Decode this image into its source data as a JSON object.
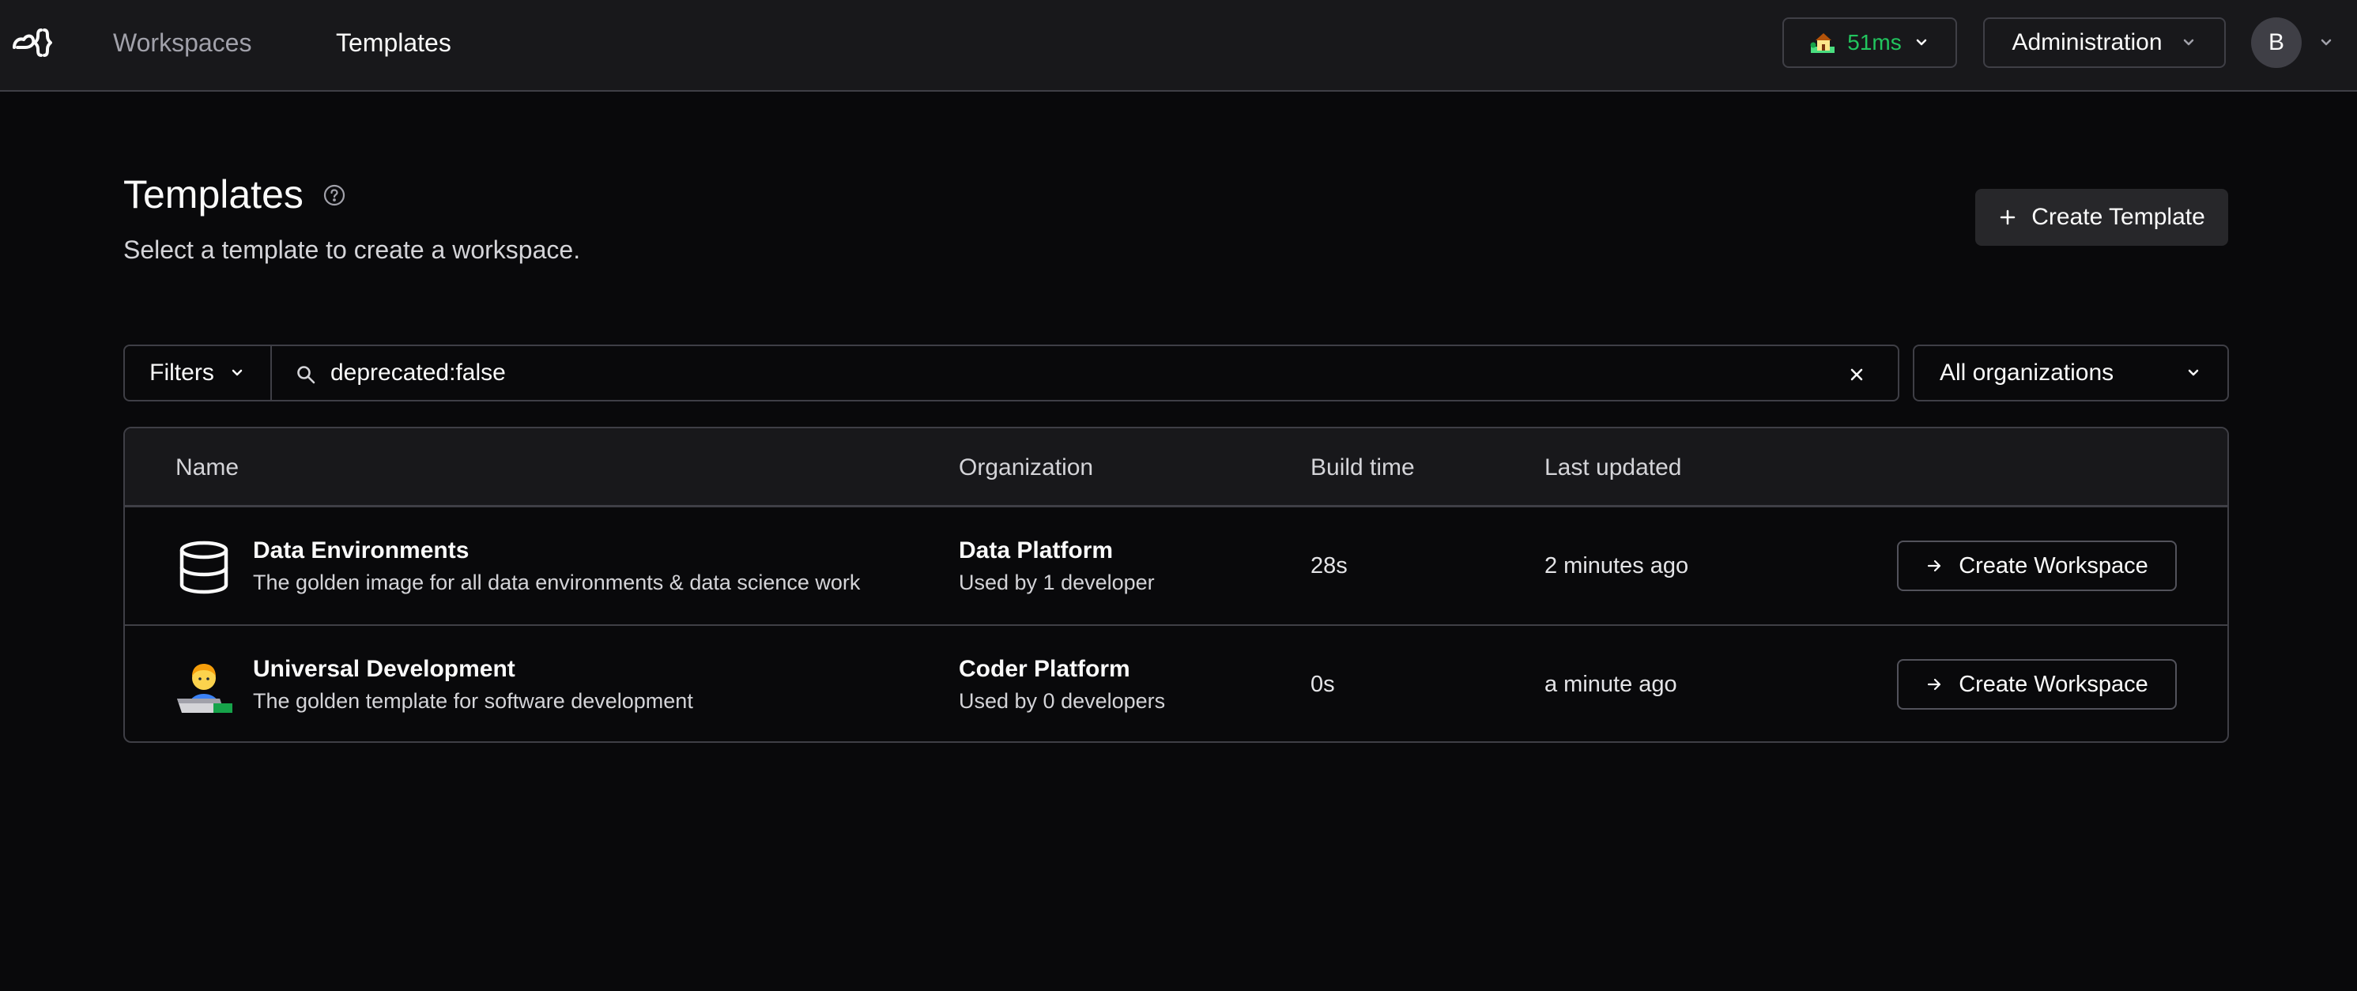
{
  "nav": {
    "workspaces_label": "Workspaces",
    "templates_label": "Templates",
    "active": "Templates"
  },
  "topbar": {
    "latency_icon": "house-with-garden-icon",
    "latency": "51ms",
    "latency_color": "#22c55e",
    "admin_label": "Administration",
    "avatar_initial": "B"
  },
  "header": {
    "title": "Templates",
    "subtitle": "Select a template to create a workspace.",
    "create_button": "Create Template"
  },
  "filters": {
    "filters_label": "Filters",
    "search_value": "deprecated:false",
    "organization_select": "All organizations"
  },
  "table": {
    "columns": [
      "Name",
      "Organization",
      "Build time",
      "Last updated"
    ],
    "rows": [
      {
        "icon": "database-icon",
        "name": "Data Environments",
        "description": "The golden image for all data environments & data science work",
        "organization": "Data Platform",
        "usage": "Used by 1 developer",
        "build_time": "28s",
        "last_updated": "2 minutes ago",
        "action": "Create Workspace"
      },
      {
        "icon": "technologist-icon",
        "name": "Universal Development",
        "description": "The golden template for software development",
        "organization": "Coder Platform",
        "usage": "Used by 0 developers",
        "build_time": "0s",
        "last_updated": "a minute ago",
        "action": "Create Workspace"
      }
    ]
  }
}
